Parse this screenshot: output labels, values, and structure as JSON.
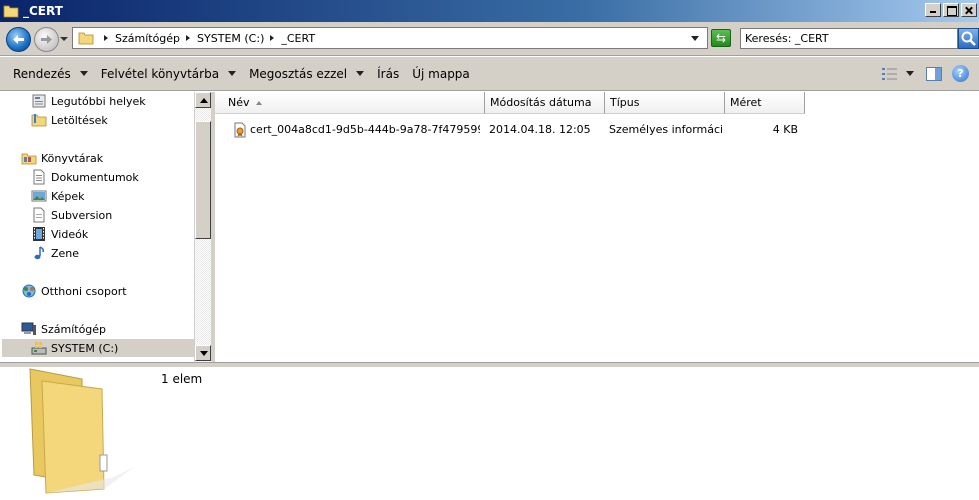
{
  "window": {
    "title": "_CERT"
  },
  "address": {
    "crumbs": [
      "Számítógép",
      "SYSTEM (C:)",
      "_CERT"
    ],
    "search_text": "Keresés: _CERT"
  },
  "toolbar": {
    "organize": "Rendezés",
    "add_to_library": "Felvétel könyvtárba",
    "share_with": "Megosztás ezzel",
    "burn": "Írás",
    "new_folder": "Új mappa"
  },
  "nav": {
    "recent": "Legutóbbi helyek",
    "downloads": "Letöltések",
    "libraries": "Könyvtárak",
    "documents": "Dokumentumok",
    "pictures": "Képek",
    "subversion": "Subversion",
    "videos": "Videók",
    "music": "Zene",
    "homegroup": "Otthoni csoport",
    "computer": "Számítógép",
    "system_c": "SYSTEM (C:)"
  },
  "columns": {
    "name": "Név",
    "modified": "Módosítás dátuma",
    "type": "Típus",
    "size": "Méret"
  },
  "files": [
    {
      "name": "cert_004a8cd1-9d5b-444b-9a78-7f4795996...",
      "modified": "2014.04.18. 12:05",
      "type": "Személyes informáci...",
      "size": "4 KB"
    }
  ],
  "details": {
    "count": "1 elem"
  },
  "colors": {
    "folder": "#f3d77a",
    "selection": "#d4d0c8",
    "title_bar": "#0a246a"
  }
}
